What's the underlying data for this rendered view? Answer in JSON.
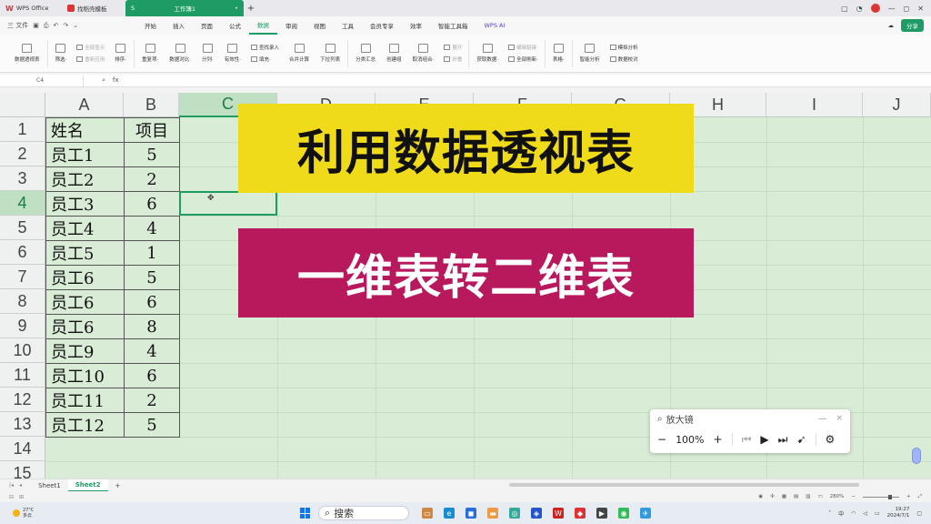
{
  "titlebar": {
    "tabs": [
      {
        "label": "WPS Office"
      },
      {
        "label": "找稻壳模板"
      },
      {
        "label": "工作簿1"
      }
    ],
    "new_tab_label": "+"
  },
  "menubar": {
    "file_label": "三 文件",
    "items": [
      "开始",
      "插入",
      "页面",
      "公式",
      "数据",
      "审阅",
      "视图",
      "工具",
      "会员专享",
      "效率",
      "智能工具箱"
    ],
    "active_item": "数据",
    "ai_label": "WPS AI",
    "share_label": "分享"
  },
  "ribbon": {
    "groups": [
      {
        "label": "数据透视表"
      },
      {
        "label": "筛选·"
      },
      {
        "label": "排序·"
      },
      {
        "label": "重复项·"
      },
      {
        "label": "数据对比·"
      },
      {
        "label": "分列·"
      },
      {
        "label": "有效性·"
      },
      {
        "label": "合并计算"
      },
      {
        "label": "下拉列表"
      },
      {
        "label": "分类汇总"
      },
      {
        "label": "创建组"
      },
      {
        "label": "取消组合·"
      },
      {
        "label": "获取数据·"
      },
      {
        "label": "全部刷新·"
      },
      {
        "label": "智能分析"
      },
      {
        "label": "模拟分析"
      },
      {
        "label": "数据校对"
      }
    ],
    "small_items": {
      "show_all": "全部显示",
      "reapply": "重新应用",
      "find_input": "查找录入",
      "fill": "填充·",
      "expand": "展开",
      "collapse": "折叠",
      "edit_links": "编辑链接",
      "table_lookup": "表格·"
    }
  },
  "formula_bar": {
    "cell_ref": "C4",
    "fx_label": "fx",
    "zoom_icon": "magnifier-icon"
  },
  "grid": {
    "columns": [
      "A",
      "B",
      "C",
      "D",
      "E",
      "F",
      "G",
      "H",
      "I",
      "J"
    ],
    "rows": [
      "1",
      "2",
      "3",
      "4",
      "5",
      "6",
      "7",
      "8",
      "9",
      "10",
      "11",
      "12",
      "13",
      "14",
      "15"
    ],
    "active_column": "C",
    "active_row": "4",
    "table": [
      [
        "姓名",
        "项目"
      ],
      [
        "员工1",
        "5"
      ],
      [
        "员工2",
        "2"
      ],
      [
        "员工3",
        "6"
      ],
      [
        "员工4",
        "4"
      ],
      [
        "员工5",
        "1"
      ],
      [
        "员工6",
        "5"
      ],
      [
        "员工6",
        "6"
      ],
      [
        "员工6",
        "8"
      ],
      [
        "员工9",
        "4"
      ],
      [
        "员工10",
        "6"
      ],
      [
        "员工11",
        "2"
      ],
      [
        "员工12",
        "5"
      ]
    ]
  },
  "overlay": {
    "title_line1": "利用数据透视表",
    "title_line2": "一维表转二维表",
    "banner1_color": "#f0db1a",
    "banner2_color": "#b8195c"
  },
  "magnifier": {
    "title": "放大镜",
    "zoom": "100%",
    "minus": "−",
    "plus": "+",
    "close": "×",
    "minimize": "—"
  },
  "sheetbar": {
    "tabs": [
      "Sheet1",
      "Sheet2"
    ],
    "active_tab": "Sheet2",
    "add_label": "+"
  },
  "statusbar": {
    "zoom": "280%"
  },
  "taskbar": {
    "weather_temp": "27°C",
    "weather_desc": "多云",
    "search_label": "搜索",
    "ime": "中",
    "time": "19:27",
    "date": "2024/7/1"
  },
  "colors": {
    "accent": "#1f9b66",
    "grid_bg": "#d9ecd6"
  }
}
